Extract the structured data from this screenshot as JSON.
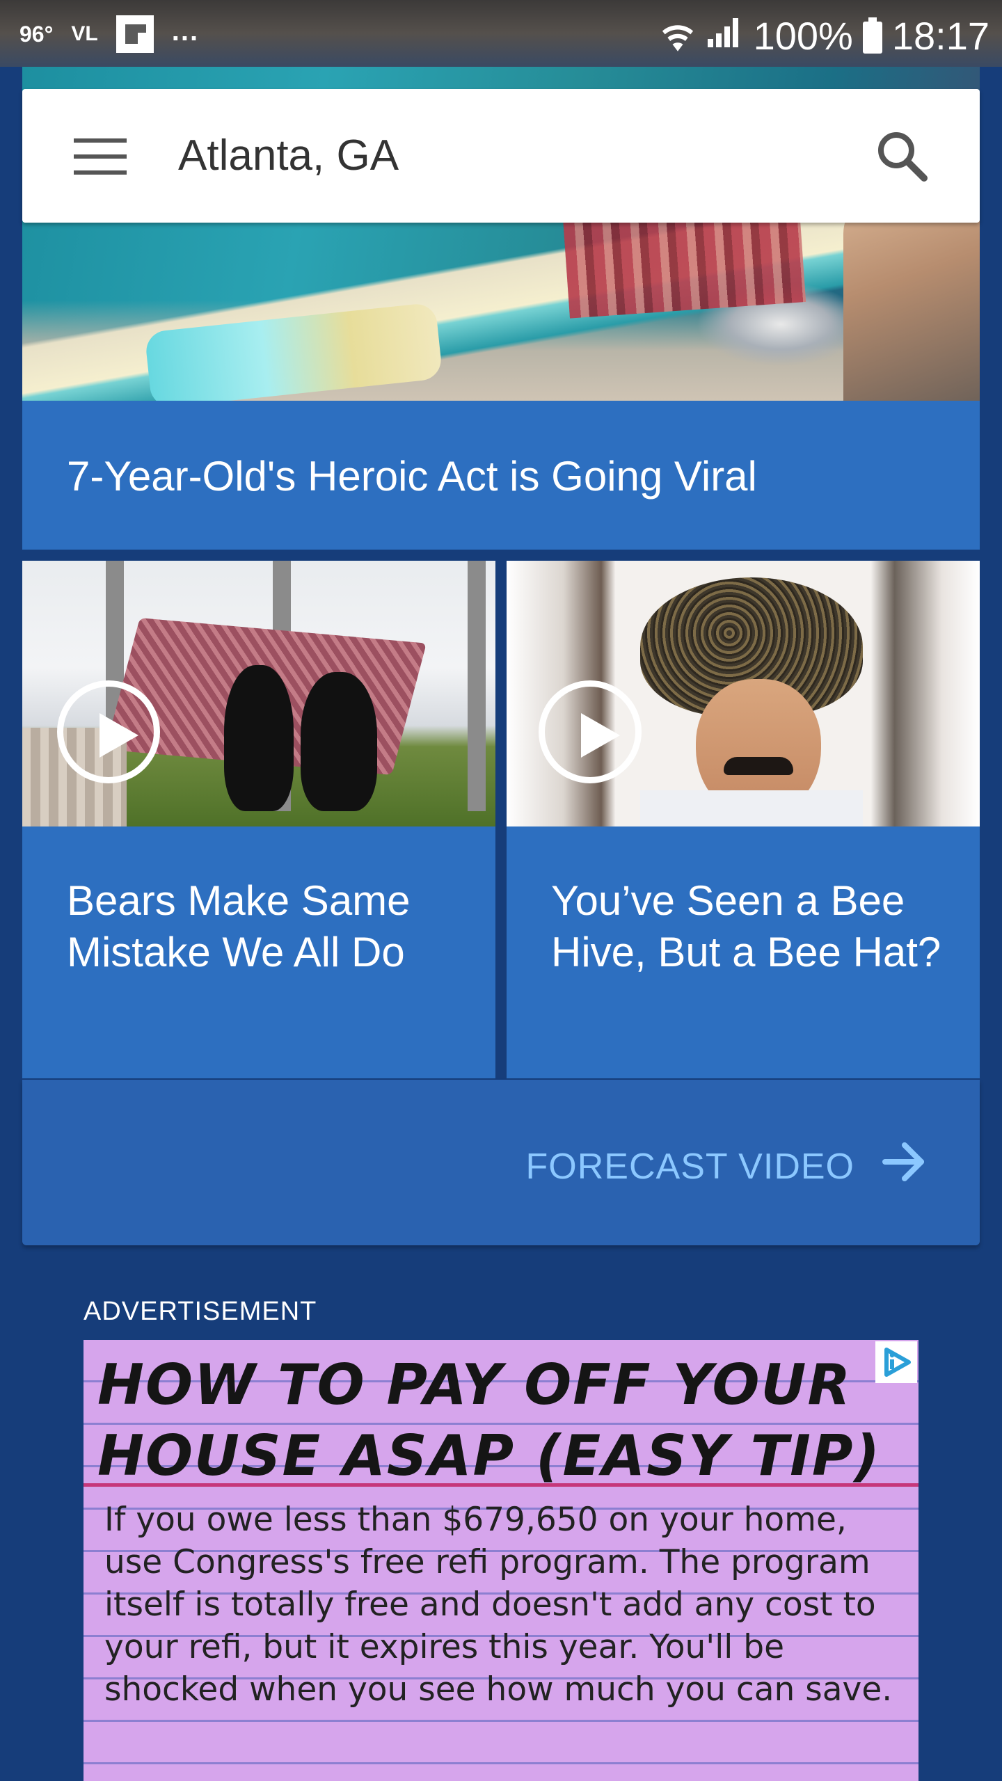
{
  "status_bar": {
    "temperature": "96°",
    "carrier_tag": "VL",
    "more_indicator": "...",
    "battery": "100%",
    "time": "18:17"
  },
  "header": {
    "location": "Atlanta, GA",
    "menu_icon": "hamburger-menu-icon",
    "search_icon": "search-icon"
  },
  "hero": {
    "headline": "7-Year-Old's Heroic Act is Going Viral"
  },
  "videos": [
    {
      "headline": "Bears Make Same Mistake We All Do",
      "icon": "play-icon"
    },
    {
      "headline": "You’ve Seen a Bee Hive, But a Bee Hat?",
      "icon": "play-icon"
    }
  ],
  "forecast": {
    "label": "FORECAST VIDEO",
    "icon": "arrow-right-icon"
  },
  "advertisement": {
    "label": "ADVERTISEMENT",
    "title_line1": "HOW TO PAY OFF YOUR",
    "title_line2": "HOUSE ASAP (EASY TIP)",
    "body": "If you owe less than $679,650 on your home, use Congress's free refi program. The program itself is totally free and doesn't add any cost to your refi, but it expires this year. You'll be shocked when you see how much you can save.",
    "choices_icon": "adchoices-icon"
  },
  "colors": {
    "background": "#163d7a",
    "card": "#2d6fc0",
    "forecast_row": "#2a62b0",
    "forecast_link": "#8cc8ff",
    "ad_background": "#d6a5ec"
  }
}
